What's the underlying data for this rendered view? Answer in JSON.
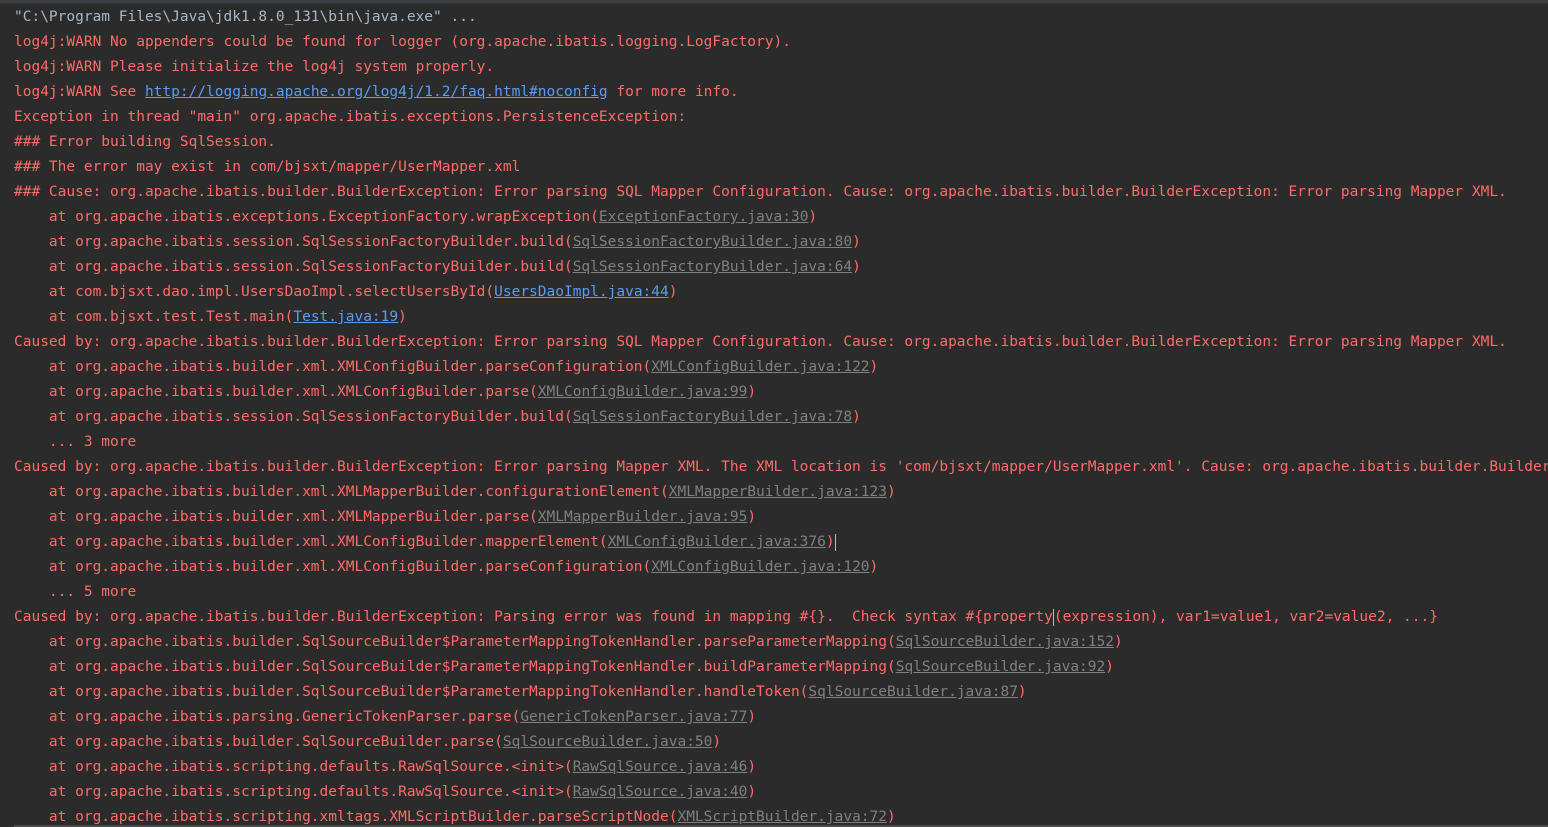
{
  "colors": {
    "background": "#2b2b2b",
    "stderr_text": "#ff6b68",
    "command_text": "#a9b7c6",
    "hyperlink": "#589df6",
    "source_link": "#808080"
  },
  "console": {
    "command": "\"C:\\Program Files\\Java\\jdk1.8.0_131\\bin\\java.exe\" ...",
    "warn_1": "log4j:WARN No appenders could be found for logger (org.apache.ibatis.logging.LogFactory).",
    "warn_2": "log4j:WARN Please initialize the log4j system properly.",
    "warn_3_prefix": "log4j:WARN See ",
    "warn_3_link": "http://logging.apache.org/log4j/1.2/faq.html#noconfig",
    "warn_3_suffix": " for more info.",
    "exception_header": "Exception in thread \"main\" org.apache.ibatis.exceptions.PersistenceException: ",
    "error_building": "### Error building SqlSession.",
    "error_may_exist": "### The error may exist in com/bjsxt/mapper/UserMapper.xml",
    "cause": "### Cause: org.apache.ibatis.builder.BuilderException: Error parsing SQL Mapper Configuration. Cause: org.apache.ibatis.builder.BuilderException: Error parsing Mapper XML.",
    "trace1": [
      {
        "method": "    at org.apache.ibatis.exceptions.ExceptionFactory.wrapException(",
        "source": "ExceptionFactory.java:30",
        "kind": "src"
      },
      {
        "method": "    at org.apache.ibatis.session.SqlSessionFactoryBuilder.build(",
        "source": "SqlSessionFactoryBuilder.java:80",
        "kind": "src"
      },
      {
        "method": "    at org.apache.ibatis.session.SqlSessionFactoryBuilder.build(",
        "source": "SqlSessionFactoryBuilder.java:64",
        "kind": "src"
      },
      {
        "method": "    at com.bjsxt.dao.impl.UsersDaoImpl.selectUsersById(",
        "source": "UsersDaoImpl.java:44",
        "kind": "link"
      },
      {
        "method": "    at com.bjsxt.test.Test.main(",
        "source": "Test.java:19",
        "kind": "link"
      }
    ],
    "caused_by_1": "Caused by: org.apache.ibatis.builder.BuilderException: Error parsing SQL Mapper Configuration. Cause: org.apache.ibatis.builder.BuilderException: Error parsing Mapper XML.",
    "trace2": [
      {
        "method": "    at org.apache.ibatis.builder.xml.XMLConfigBuilder.parseConfiguration(",
        "source": "XMLConfigBuilder.java:122",
        "kind": "src"
      },
      {
        "method": "    at org.apache.ibatis.builder.xml.XMLConfigBuilder.parse(",
        "source": "XMLConfigBuilder.java:99",
        "kind": "src"
      },
      {
        "method": "    at org.apache.ibatis.session.SqlSessionFactoryBuilder.build(",
        "source": "SqlSessionFactoryBuilder.java:78",
        "kind": "src"
      }
    ],
    "more_1": "    ... 3 more",
    "caused_by_2": "Caused by: org.apache.ibatis.builder.BuilderException: Error parsing Mapper XML. The XML location is 'com/bjsxt/mapper/UserMapper.xml'. Cause: org.apache.ibatis.builder.BuilderException",
    "trace3": [
      {
        "method": "    at org.apache.ibatis.builder.xml.XMLMapperBuilder.configurationElement(",
        "source": "XMLMapperBuilder.java:123",
        "kind": "src"
      },
      {
        "method": "    at org.apache.ibatis.builder.xml.XMLMapperBuilder.parse(",
        "source": "XMLMapperBuilder.java:95",
        "kind": "src"
      },
      {
        "method": "    at org.apache.ibatis.builder.xml.XMLConfigBuilder.mapperElement(",
        "source": "XMLConfigBuilder.java:376",
        "kind": "src",
        "caret": true
      },
      {
        "method": "    at org.apache.ibatis.builder.xml.XMLConfigBuilder.parseConfiguration(",
        "source": "XMLConfigBuilder.java:120",
        "kind": "src"
      }
    ],
    "more_2": "    ... 5 more",
    "caused_by_3_prefix": "Caused by: org.apache.ibatis.builder.BuilderException: Parsing error was found in mapping #{}.  Check syntax #{property",
    "caused_by_3_suffix": "(expression), var1=value1, var2=value2, ...}",
    "trace4": [
      {
        "method": "    at org.apache.ibatis.builder.SqlSourceBuilder$ParameterMappingTokenHandler.parseParameterMapping(",
        "source": "SqlSourceBuilder.java:152",
        "kind": "src"
      },
      {
        "method": "    at org.apache.ibatis.builder.SqlSourceBuilder$ParameterMappingTokenHandler.buildParameterMapping(",
        "source": "SqlSourceBuilder.java:92",
        "kind": "src"
      },
      {
        "method": "    at org.apache.ibatis.builder.SqlSourceBuilder$ParameterMappingTokenHandler.handleToken(",
        "source": "SqlSourceBuilder.java:87",
        "kind": "src"
      },
      {
        "method": "    at org.apache.ibatis.parsing.GenericTokenParser.parse(",
        "source": "GenericTokenParser.java:77",
        "kind": "src"
      },
      {
        "method": "    at org.apache.ibatis.builder.SqlSourceBuilder.parse(",
        "source": "SqlSourceBuilder.java:50",
        "kind": "src"
      },
      {
        "method": "    at org.apache.ibatis.scripting.defaults.RawSqlSource.<init>(",
        "source": "RawSqlSource.java:46",
        "kind": "src"
      },
      {
        "method": "    at org.apache.ibatis.scripting.defaults.RawSqlSource.<init>(",
        "source": "RawSqlSource.java:40",
        "kind": "src"
      },
      {
        "method": "    at org.apache.ibatis.scripting.xmltags.XMLScriptBuilder.parseScriptNode(",
        "source": "XMLScriptBuilder.java:72",
        "kind": "src"
      }
    ]
  }
}
